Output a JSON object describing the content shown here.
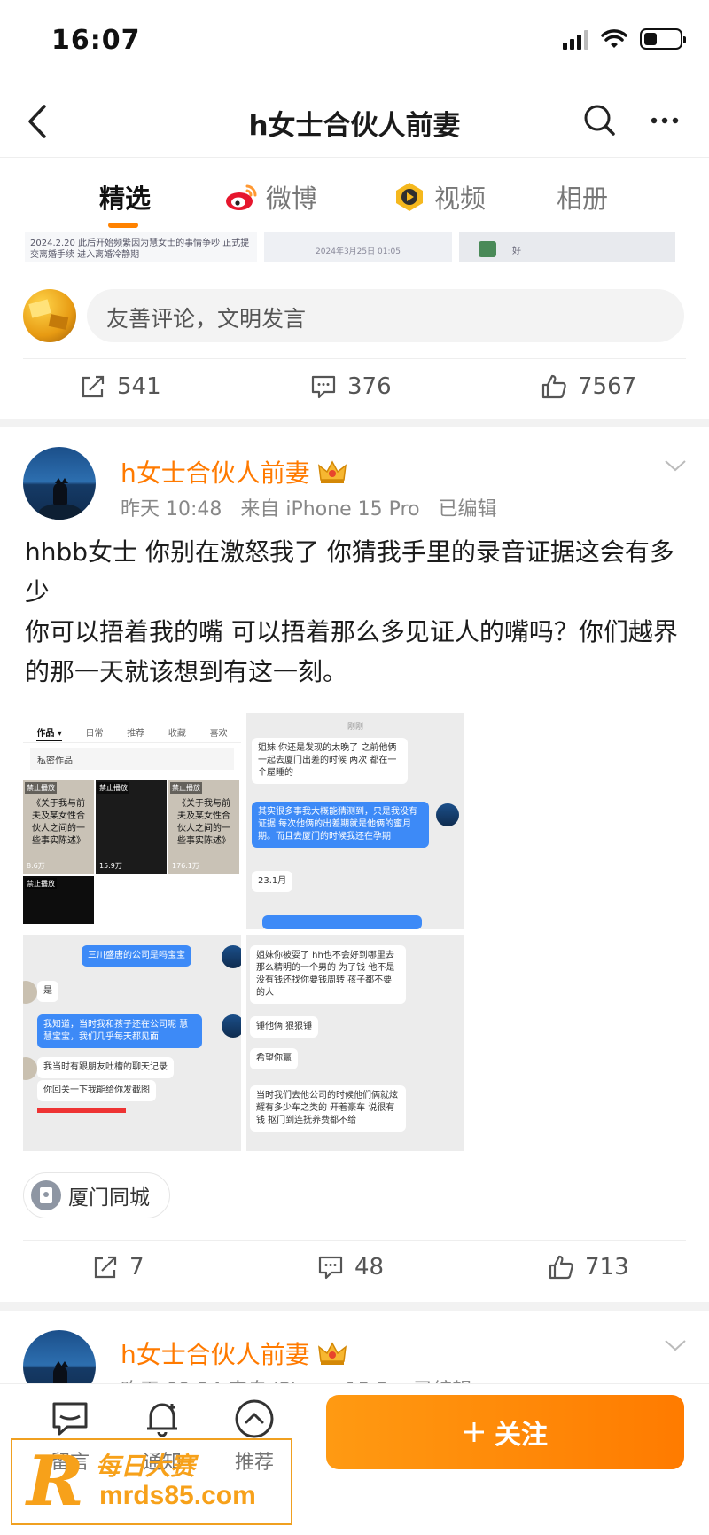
{
  "status_bar": {
    "time": "16:07"
  },
  "nav": {
    "title": "h女士合伙人前妻"
  },
  "tabs": [
    {
      "label": "精选",
      "active": true
    },
    {
      "label": "微博",
      "icon": "weibo-logo-icon"
    },
    {
      "label": "视频",
      "icon": "video-icon"
    },
    {
      "label": "相册"
    }
  ],
  "prev_post": {
    "strip_text_1": "2024.2.20 此后开始频繁因为慧女士的事情争吵 正式提交离婚手续 进入离婚冷静期",
    "strip_text_2": "2024年3月25日 01:05",
    "strip_text_3": "好",
    "comment_placeholder": "友善评论，文明发言",
    "reposts": "541",
    "comments": "376",
    "likes": "7567"
  },
  "post": {
    "username": "h女士合伙人前妻",
    "time": "昨天 10:48",
    "source": "来自 iPhone 15 Pro",
    "edited": "已编辑",
    "text_line1": "hhbb女士 你别在激怒我了 你猜我手里的录音证据这会有多少",
    "text_line2": "你可以捂着我的嘴 可以捂着那么多见证人的嘴吗？你们越界的那一天就该想到有这一刻。",
    "location": "厦门同城",
    "reposts": "7",
    "comments": "48",
    "likes": "713",
    "images": {
      "img1": {
        "tabs": [
          "作品 ▾",
          "日常",
          "推荐",
          "收藏",
          "喜欢"
        ],
        "private_label": "私密作品",
        "thumbs": [
          {
            "tag": "禁止播放",
            "title": "《关于我与前夫及某女性合伙人之间的一些事实陈述》",
            "count": "8.6万"
          },
          {
            "tag": "禁止播放",
            "title": "",
            "count": "15.9万"
          },
          {
            "tag": "禁止播放",
            "title": "《关于我与前夫及某女性合伙人之间的一些事实陈述》",
            "count": "176.1万"
          }
        ],
        "extra_tag": "禁止播放"
      },
      "img2": {
        "header": "刚刚",
        "msg1": "姐妹 你还是发现的太晚了 之前他俩一起去厦门出差的时候 两次 都在一个屋睡的",
        "msg2": "其实很多事我大概能猜测到，只是我没有证据 每次他俩的出差期就是他俩的蜜月期。而且去厦门的时候我还在孕期",
        "msg3": "23.1月"
      },
      "img3": {
        "msg1": "三川盛唐的公司是吗宝宝",
        "msg2": "是",
        "msg3": "我知道，当时我和孩子还在公司呢 慧慧宝宝，我们几乎每天都见面",
        "msg4": "我当时有跟朋友吐槽的聊天记录",
        "msg5": "你回关一下我能给你发截图"
      },
      "img4": {
        "msg1": "姐妹你被耍了 hh也不会好到哪里去 那么精明的一个男的 为了钱 他不是没有钱还找你要钱周转 孩子都不要的人",
        "msg2": "锤他俩 狠狠锤",
        "msg3": "希望你赢",
        "msg4": "当时我们去他公司的时候他们俩就炫耀有多少车之类的 开着豪车 说很有钱 抠门到连抚养费都不给"
      }
    }
  },
  "next_post": {
    "username": "h女士合伙人前妻",
    "meta": "昨天 09:24  来自 iPhone 15 Pro  已编辑"
  },
  "bottom_bar": {
    "items": [
      "留言",
      "通知",
      "推荐"
    ],
    "follow_label": "关注"
  },
  "watermark": {
    "cn": "每日大赛",
    "url": "mrds85.com"
  },
  "colors": {
    "accent": "#ff8200",
    "username": "#ff7a00",
    "bubble_blue": "#3d8af7"
  }
}
